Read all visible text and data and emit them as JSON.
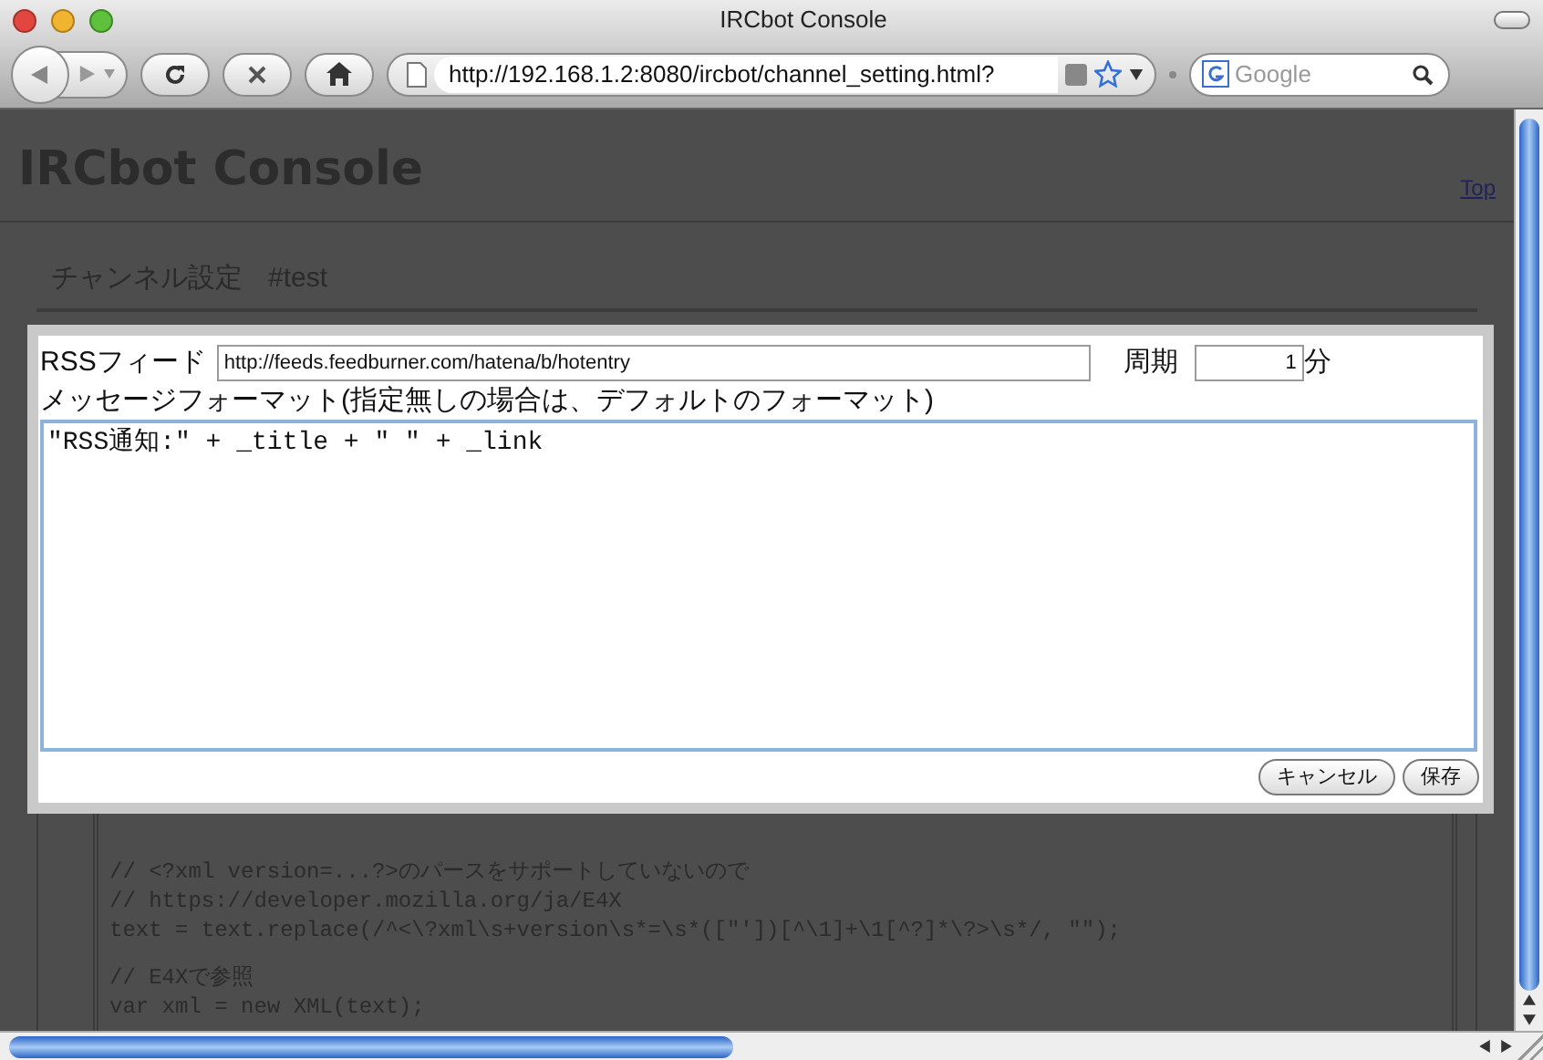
{
  "window": {
    "title": "IRCbot Console"
  },
  "toolbar": {
    "url": "http://192.168.1.2:8080/ircbot/channel_setting.html?",
    "search_placeholder": "Google"
  },
  "page": {
    "heading": "IRCbot Console",
    "top_link": "Top",
    "section_title": "チャンネル設定",
    "channel": "#test"
  },
  "dialog": {
    "rss_label": "RSSフィード",
    "rss_value": "http://feeds.feedburner.com/hatena/b/hotentry",
    "period_label": "周期",
    "period_value": "1",
    "period_unit": "分",
    "format_label": "メッセージフォーマット(指定無しの場合は、デフォルトのフォーマット)",
    "format_value": "\"RSS通知:\" + _title + \" \" + _link",
    "buttons": [
      "キャンセル",
      "保存"
    ]
  },
  "code_blocks": [
    {
      "lines": [
        "// <?xml version=...?>のパースをサポートしていないので",
        "// https://developer.mozilla.org/ja/E4X",
        "text = text.replace(/^<\\?xml\\s+version\\s*=\\s*([\"'])[^\\1]+\\1[^?]*\\?>\\s*/, \"\");"
      ]
    },
    {
      "lines": [
        "// E4Xで参照",
        "var xml = new XML(text);"
      ]
    }
  ]
}
